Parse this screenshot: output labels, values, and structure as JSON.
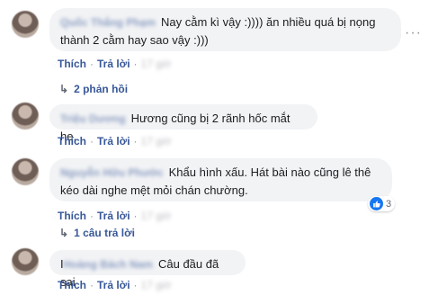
{
  "comments": [
    {
      "author": "Quốc Thắng Phạm",
      "text": "Nay cằm kì vậy :)))) ăn nhiều quá bị nọng thành 2 cằm hay sao vậy :)))",
      "like_label": "Thích",
      "reply_label": "Trả lời",
      "time": "17 giờ",
      "replies_label": "2 phản hồi"
    },
    {
      "author": "Triệu Dương",
      "text": "Hương cũng bị 2 rãnh hốc mắt he.",
      "like_label": "Thích",
      "reply_label": "Trả lời",
      "time": "17 giờ"
    },
    {
      "author": "Nguyễn Hữu Phước",
      "text": "Khẩu hình xấu. Hát bài nào cũng lê thê kéo dài nghe mệt mỏi chán chường.",
      "like_label": "Thích",
      "reply_label": "Trả lời",
      "time": "17 giờ",
      "reaction_count": "3",
      "replies_label": "1 câu trả lời"
    },
    {
      "author": "Hoàng Bách Nam",
      "prefix": "I",
      "text": "Câu đầu đã sai",
      "like_label": "Thích",
      "reply_label": "Trả lời",
      "time": "17 giờ"
    }
  ],
  "colors": {
    "link": "#385898",
    "bubble": "#f2f3f5",
    "like": "#1877f2"
  },
  "icons": [
    "more-options-icon",
    "reply-arrow-icon",
    "like-reaction-icon"
  ]
}
